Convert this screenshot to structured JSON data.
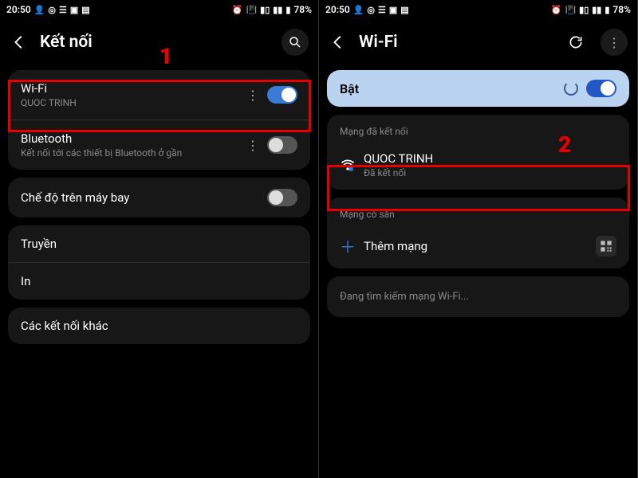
{
  "statusbar": {
    "time": "20:50",
    "battery": "78%"
  },
  "left": {
    "title": "Kết nối",
    "annotation": "1",
    "items": {
      "wifi": {
        "title": "Wi-Fi",
        "sub": "QUOC TRINH"
      },
      "bluetooth": {
        "title": "Bluetooth",
        "sub": "Kết nối tới các thiết bị Bluetooth ở gần"
      },
      "airplane": {
        "title": "Chế độ trên máy bay"
      },
      "cast": {
        "title": "Truyền"
      },
      "print": {
        "title": "In"
      },
      "more": {
        "title": "Các kết nối khác"
      }
    }
  },
  "right": {
    "title": "Wi-Fi",
    "annotation": "2",
    "onLabel": "Bật",
    "connectedHeader": "Mạng đã kết nối",
    "connected": {
      "name": "QUOC TRINH",
      "status": "Đã kết nối"
    },
    "availableHeader": "Mạng có sẵn",
    "addNetwork": "Thêm mạng",
    "searching": "Đang tìm kiếm mạng Wi-Fi..."
  }
}
